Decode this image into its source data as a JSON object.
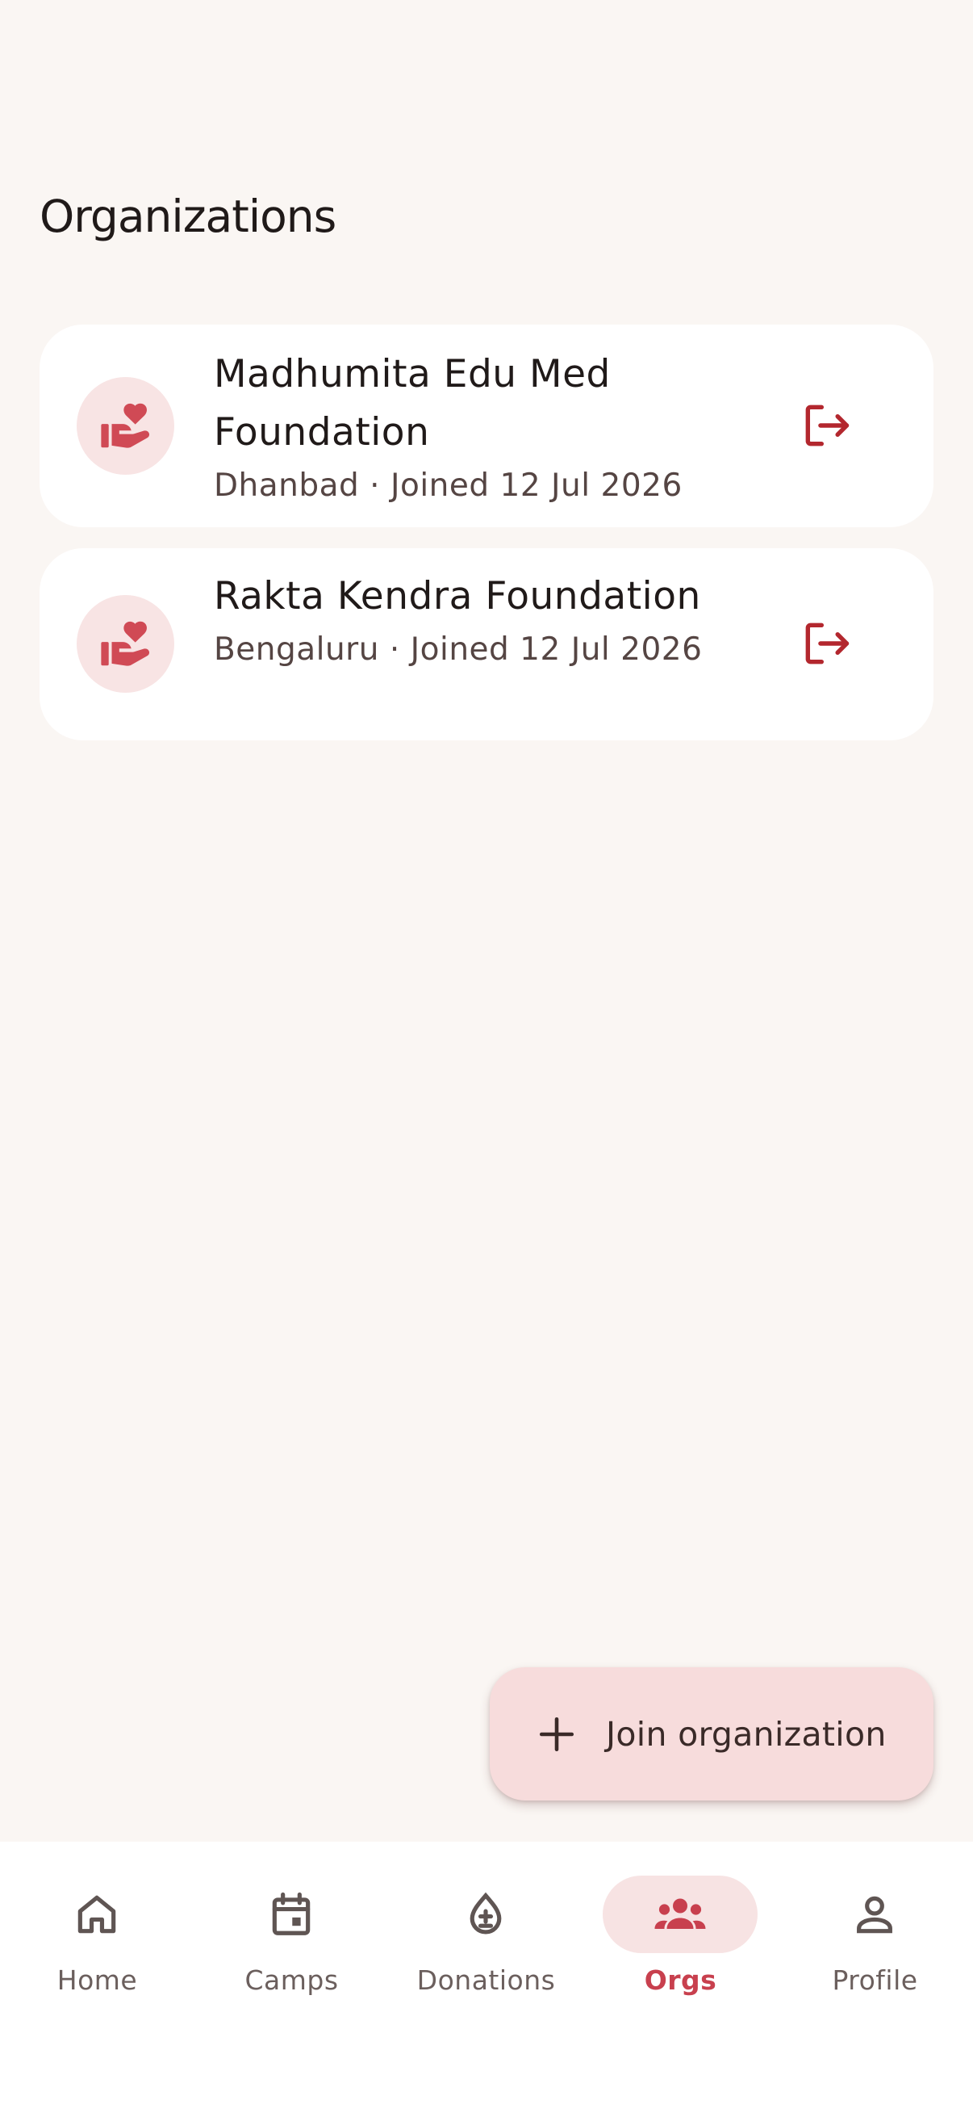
{
  "page": {
    "title": "Organizations"
  },
  "organizations": [
    {
      "name": "Madhumita Edu Med Foundation",
      "meta": "Dhanbad · Joined 12 Jul 2026",
      "icon": "volunteer-activism-icon",
      "action_icon": "logout-icon"
    },
    {
      "name": "Rakta Kendra Foundation",
      "meta": "Bengaluru · Joined 12 Jul 2026",
      "icon": "volunteer-activism-icon",
      "action_icon": "logout-icon"
    }
  ],
  "fab": {
    "label": "Join organization",
    "icon": "plus-icon"
  },
  "nav": {
    "items": [
      {
        "label": "Home",
        "icon": "home-icon",
        "active": false
      },
      {
        "label": "Camps",
        "icon": "calendar-icon",
        "active": false
      },
      {
        "label": "Donations",
        "icon": "blood-drop-icon",
        "active": false
      },
      {
        "label": "Orgs",
        "icon": "groups-icon",
        "active": true
      },
      {
        "label": "Profile",
        "icon": "person-icon",
        "active": false
      }
    ]
  },
  "colors": {
    "background": "#faf6f3",
    "accent": "#c8404e",
    "accent_dark": "#b3272e",
    "accent_container": "#f7dcdc",
    "card": "#ffffff"
  }
}
